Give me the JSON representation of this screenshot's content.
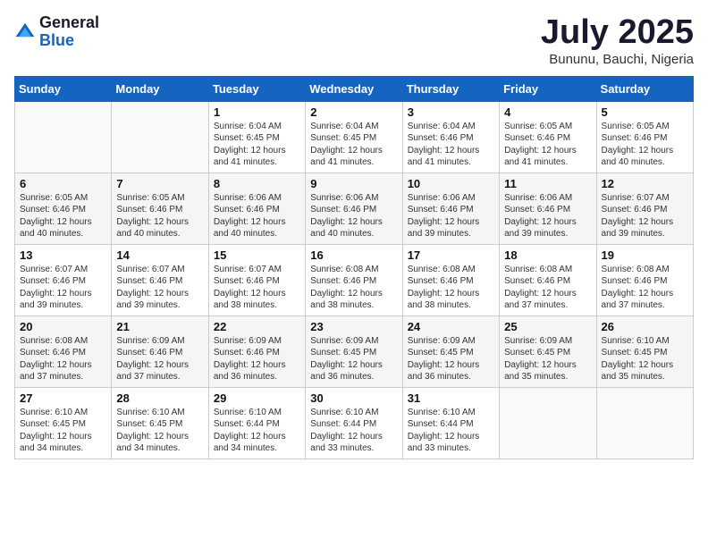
{
  "header": {
    "logo_general": "General",
    "logo_blue": "Blue",
    "month": "July 2025",
    "location": "Bununu, Bauchi, Nigeria"
  },
  "days_of_week": [
    "Sunday",
    "Monday",
    "Tuesday",
    "Wednesday",
    "Thursday",
    "Friday",
    "Saturday"
  ],
  "weeks": [
    [
      {
        "day": "",
        "info": ""
      },
      {
        "day": "",
        "info": ""
      },
      {
        "day": "1",
        "info": "Sunrise: 6:04 AM\nSunset: 6:45 PM\nDaylight: 12 hours and 41 minutes."
      },
      {
        "day": "2",
        "info": "Sunrise: 6:04 AM\nSunset: 6:45 PM\nDaylight: 12 hours and 41 minutes."
      },
      {
        "day": "3",
        "info": "Sunrise: 6:04 AM\nSunset: 6:46 PM\nDaylight: 12 hours and 41 minutes."
      },
      {
        "day": "4",
        "info": "Sunrise: 6:05 AM\nSunset: 6:46 PM\nDaylight: 12 hours and 41 minutes."
      },
      {
        "day": "5",
        "info": "Sunrise: 6:05 AM\nSunset: 6:46 PM\nDaylight: 12 hours and 40 minutes."
      }
    ],
    [
      {
        "day": "6",
        "info": "Sunrise: 6:05 AM\nSunset: 6:46 PM\nDaylight: 12 hours and 40 minutes."
      },
      {
        "day": "7",
        "info": "Sunrise: 6:05 AM\nSunset: 6:46 PM\nDaylight: 12 hours and 40 minutes."
      },
      {
        "day": "8",
        "info": "Sunrise: 6:06 AM\nSunset: 6:46 PM\nDaylight: 12 hours and 40 minutes."
      },
      {
        "day": "9",
        "info": "Sunrise: 6:06 AM\nSunset: 6:46 PM\nDaylight: 12 hours and 40 minutes."
      },
      {
        "day": "10",
        "info": "Sunrise: 6:06 AM\nSunset: 6:46 PM\nDaylight: 12 hours and 39 minutes."
      },
      {
        "day": "11",
        "info": "Sunrise: 6:06 AM\nSunset: 6:46 PM\nDaylight: 12 hours and 39 minutes."
      },
      {
        "day": "12",
        "info": "Sunrise: 6:07 AM\nSunset: 6:46 PM\nDaylight: 12 hours and 39 minutes."
      }
    ],
    [
      {
        "day": "13",
        "info": "Sunrise: 6:07 AM\nSunset: 6:46 PM\nDaylight: 12 hours and 39 minutes."
      },
      {
        "day": "14",
        "info": "Sunrise: 6:07 AM\nSunset: 6:46 PM\nDaylight: 12 hours and 39 minutes."
      },
      {
        "day": "15",
        "info": "Sunrise: 6:07 AM\nSunset: 6:46 PM\nDaylight: 12 hours and 38 minutes."
      },
      {
        "day": "16",
        "info": "Sunrise: 6:08 AM\nSunset: 6:46 PM\nDaylight: 12 hours and 38 minutes."
      },
      {
        "day": "17",
        "info": "Sunrise: 6:08 AM\nSunset: 6:46 PM\nDaylight: 12 hours and 38 minutes."
      },
      {
        "day": "18",
        "info": "Sunrise: 6:08 AM\nSunset: 6:46 PM\nDaylight: 12 hours and 37 minutes."
      },
      {
        "day": "19",
        "info": "Sunrise: 6:08 AM\nSunset: 6:46 PM\nDaylight: 12 hours and 37 minutes."
      }
    ],
    [
      {
        "day": "20",
        "info": "Sunrise: 6:08 AM\nSunset: 6:46 PM\nDaylight: 12 hours and 37 minutes."
      },
      {
        "day": "21",
        "info": "Sunrise: 6:09 AM\nSunset: 6:46 PM\nDaylight: 12 hours and 37 minutes."
      },
      {
        "day": "22",
        "info": "Sunrise: 6:09 AM\nSunset: 6:46 PM\nDaylight: 12 hours and 36 minutes."
      },
      {
        "day": "23",
        "info": "Sunrise: 6:09 AM\nSunset: 6:45 PM\nDaylight: 12 hours and 36 minutes."
      },
      {
        "day": "24",
        "info": "Sunrise: 6:09 AM\nSunset: 6:45 PM\nDaylight: 12 hours and 36 minutes."
      },
      {
        "day": "25",
        "info": "Sunrise: 6:09 AM\nSunset: 6:45 PM\nDaylight: 12 hours and 35 minutes."
      },
      {
        "day": "26",
        "info": "Sunrise: 6:10 AM\nSunset: 6:45 PM\nDaylight: 12 hours and 35 minutes."
      }
    ],
    [
      {
        "day": "27",
        "info": "Sunrise: 6:10 AM\nSunset: 6:45 PM\nDaylight: 12 hours and 34 minutes."
      },
      {
        "day": "28",
        "info": "Sunrise: 6:10 AM\nSunset: 6:45 PM\nDaylight: 12 hours and 34 minutes."
      },
      {
        "day": "29",
        "info": "Sunrise: 6:10 AM\nSunset: 6:44 PM\nDaylight: 12 hours and 34 minutes."
      },
      {
        "day": "30",
        "info": "Sunrise: 6:10 AM\nSunset: 6:44 PM\nDaylight: 12 hours and 33 minutes."
      },
      {
        "day": "31",
        "info": "Sunrise: 6:10 AM\nSunset: 6:44 PM\nDaylight: 12 hours and 33 minutes."
      },
      {
        "day": "",
        "info": ""
      },
      {
        "day": "",
        "info": ""
      }
    ]
  ]
}
